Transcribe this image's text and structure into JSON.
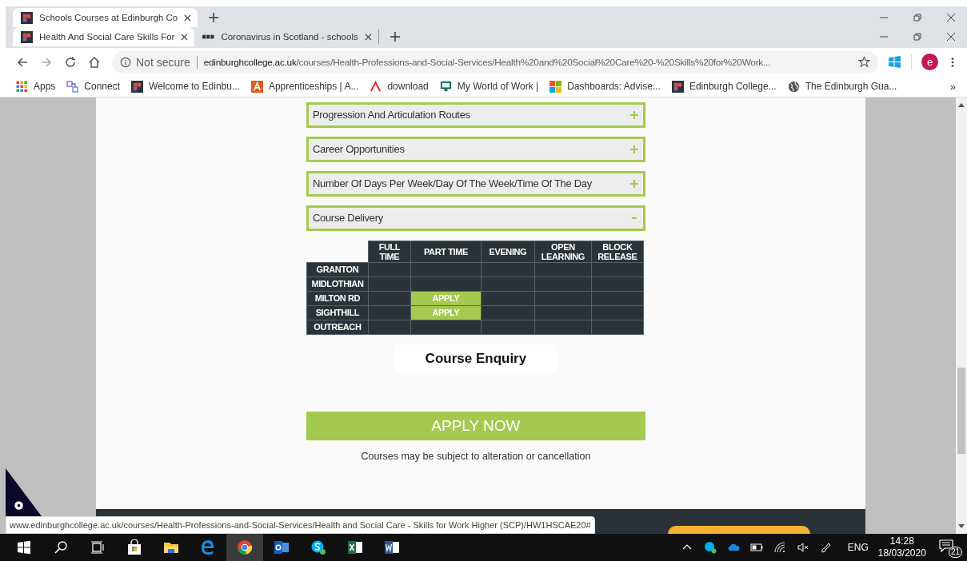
{
  "tab_rows": [
    {
      "tabs": [
        {
          "title": "Schools Courses at Edinburgh Co",
          "selected": true
        }
      ]
    },
    {
      "tabs": [
        {
          "title": "Health And Social Care Skills For",
          "selected": true
        },
        {
          "title": "Coronavirus in Scotland - schools",
          "selected": false,
          "kind": "news"
        }
      ]
    }
  ],
  "address_bar": {
    "security": "Not secure",
    "domain": "edinburghcollege.ac.uk",
    "path": "/courses/Health-Professions-and-Social-Services/Health%20and%20Social%20Care%20-%20Skills%20for%20Work..."
  },
  "profile": {
    "initial": "e"
  },
  "bookmarks": [
    {
      "label": "Apps",
      "kind": "apps"
    },
    {
      "label": "Connect",
      "kind": "connect"
    },
    {
      "label": "Welcome to Edinbu...",
      "kind": "college"
    },
    {
      "label": "Apprenticeships | A...",
      "kind": "letter-a"
    },
    {
      "label": "download",
      "kind": "chevron"
    },
    {
      "label": "My World of Work |",
      "kind": "monitor"
    },
    {
      "label": "Dashboards: Advise...",
      "kind": "squares"
    },
    {
      "label": "Edinburgh College...",
      "kind": "college"
    },
    {
      "label": "The Edinburgh Gua...",
      "kind": "globe"
    }
  ],
  "bookmarks_more": "»",
  "accordions": [
    {
      "title": "Progression And Articulation Routes",
      "expanded": false
    },
    {
      "title": "Career Opportunities",
      "expanded": false
    },
    {
      "title": "Number Of Days Per Week/Day Of The Week/Time Of The Day",
      "expanded": false
    },
    {
      "title": "Course Delivery",
      "expanded": true
    }
  ],
  "delivery_table": {
    "columns": [
      "FULL TIME",
      "PART TIME",
      "EVENING",
      "OPEN LEARNING",
      "BLOCK RELEASE"
    ],
    "rows": [
      {
        "campus": "GRANTON",
        "cells": [
          {
            "kind": "empty"
          },
          {
            "kind": "empty"
          },
          {
            "kind": "empty"
          },
          {
            "kind": "empty"
          },
          {
            "kind": "empty"
          }
        ]
      },
      {
        "campus": "MIDLOTHIAN",
        "cells": [
          {
            "kind": "empty"
          },
          {
            "kind": "empty"
          },
          {
            "kind": "empty"
          },
          {
            "kind": "empty"
          },
          {
            "kind": "empty"
          }
        ]
      },
      {
        "campus": "MILTON RD",
        "cells": [
          {
            "kind": "empty"
          },
          {
            "kind": "apply",
            "label": "APPLY"
          },
          {
            "kind": "empty"
          },
          {
            "kind": "empty"
          },
          {
            "kind": "empty"
          }
        ]
      },
      {
        "campus": "SIGHTHILL",
        "cells": [
          {
            "kind": "empty"
          },
          {
            "kind": "apply",
            "label": "APPLY"
          },
          {
            "kind": "empty"
          },
          {
            "kind": "empty"
          },
          {
            "kind": "empty"
          }
        ]
      },
      {
        "campus": "OUTREACH",
        "cells": [
          {
            "kind": "empty"
          },
          {
            "kind": "empty"
          },
          {
            "kind": "empty"
          },
          {
            "kind": "empty"
          },
          {
            "kind": "empty"
          }
        ]
      }
    ]
  },
  "enquiry_button": "Course Enquiry",
  "apply_button": "APPLY NOW",
  "note": "Courses may be subject to alteration or cancellation",
  "status_url": "www.edinburghcollege.ac.uk/courses/Health-Professions-and-Social-Services/Health and Social Care - Skills for Work Higher (SCP)/HW1HSCAE20#",
  "taskbar": {
    "apps": [
      {
        "kind": "start",
        "selected": false
      },
      {
        "kind": "search",
        "selected": false
      },
      {
        "kind": "task-view",
        "selected": false
      },
      {
        "kind": "store",
        "selected": false
      },
      {
        "kind": "explorer",
        "selected": false
      },
      {
        "kind": "edge",
        "selected": false
      },
      {
        "kind": "chrome",
        "selected": true
      },
      {
        "kind": "outlook",
        "selected": false
      },
      {
        "kind": "skype",
        "selected": false
      },
      {
        "kind": "excel",
        "selected": false
      },
      {
        "kind": "word",
        "selected": false
      }
    ],
    "language": "ENG",
    "time": "14:28",
    "date": "18/03/2020",
    "notifications": "21"
  }
}
